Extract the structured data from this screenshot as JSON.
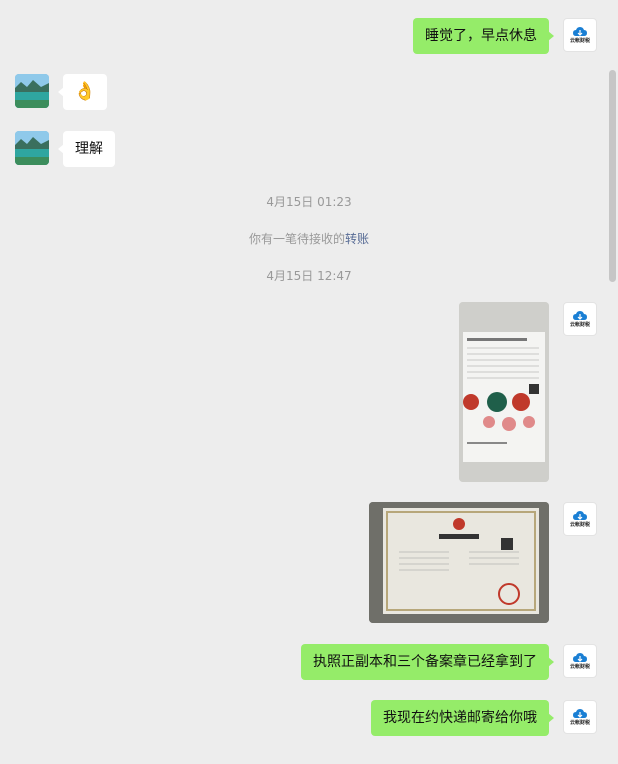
{
  "contacts": {
    "self_avatar_label": "云帐财税",
    "other_avatar_label": "lake-landscape-avatar"
  },
  "messages": [
    {
      "type": "text",
      "side": "self",
      "text": "睡觉了，早点休息"
    },
    {
      "type": "emoji",
      "side": "other",
      "emoji": "👌"
    },
    {
      "type": "text",
      "side": "other",
      "text": "理解"
    },
    {
      "type": "system",
      "text": "4月15日 01:23"
    },
    {
      "type": "system",
      "text_prefix": "你有一笔待接收的",
      "link": "转账"
    },
    {
      "type": "system",
      "text": "4月15日 12:47"
    },
    {
      "type": "image",
      "side": "self",
      "description_icon": "document-photo-icon"
    },
    {
      "type": "image",
      "side": "self",
      "description_icon": "business-license-photo-icon",
      "image_title": "营业执照",
      "image_subtitle": "副本"
    },
    {
      "type": "text",
      "side": "self",
      "text": "执照正副本和三个备案章已经拿到了"
    },
    {
      "type": "text",
      "side": "self",
      "text": "我现在约快递邮寄给你哦"
    }
  ],
  "colors": {
    "background": "#ededed",
    "self_bubble": "#95ec69",
    "other_bubble": "#ffffff",
    "link": "#576b95",
    "system_text": "#999999"
  }
}
